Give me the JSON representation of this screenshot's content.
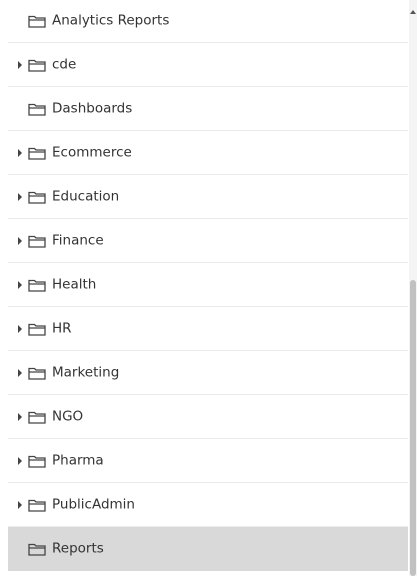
{
  "tree": {
    "items": [
      {
        "label": "Analytics Reports",
        "expandable": false,
        "selected": false
      },
      {
        "label": "cde",
        "expandable": true,
        "selected": false
      },
      {
        "label": "Dashboards",
        "expandable": false,
        "selected": false
      },
      {
        "label": "Ecommerce",
        "expandable": true,
        "selected": false
      },
      {
        "label": "Education",
        "expandable": true,
        "selected": false
      },
      {
        "label": "Finance",
        "expandable": true,
        "selected": false
      },
      {
        "label": "Health",
        "expandable": true,
        "selected": false
      },
      {
        "label": "HR",
        "expandable": true,
        "selected": false
      },
      {
        "label": "Marketing",
        "expandable": true,
        "selected": false
      },
      {
        "label": "NGO",
        "expandable": true,
        "selected": false
      },
      {
        "label": "Pharma",
        "expandable": true,
        "selected": false
      },
      {
        "label": "PublicAdmin",
        "expandable": true,
        "selected": false
      },
      {
        "label": "Reports",
        "expandable": false,
        "selected": true
      }
    ],
    "icon": "folder-icon",
    "expand_icon": "caret-right-icon"
  },
  "colors": {
    "selected_background": "#d9d9d9",
    "text": "#333333",
    "divider": "#ececec",
    "scroll_thumb": "#c1c1c1"
  }
}
